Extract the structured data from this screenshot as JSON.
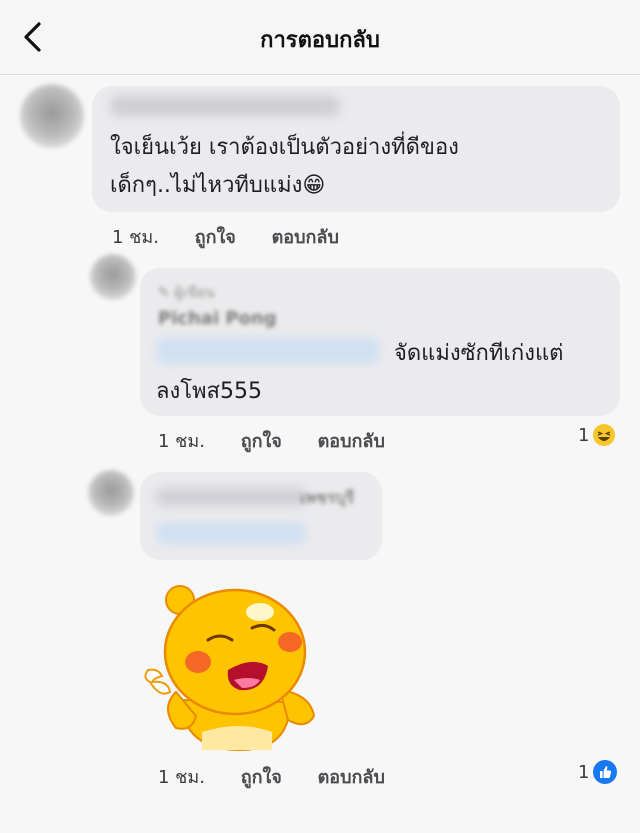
{
  "header": {
    "title": "การตอบกลับ"
  },
  "colors": {
    "like_blue": "#1877f2",
    "emoji_yellow": "#f7c52c",
    "bubble": "#ebebed"
  },
  "comments": [
    {
      "text_lines": [
        "ใจเย็นเว้ย เราต้องเป็นตัวอย่างที่ดีของ",
        "เด็กๆ..ไม่ไหวทีบแม่ง"
      ],
      "emoji": "😁",
      "time": "1 ชม.",
      "like": "ถูกใจ",
      "reply": "ตอบกลับ"
    },
    {
      "top_fan": "ผู้เขียน",
      "author": "Pichai Pong",
      "text_line1": "จัดแม่งซักทีเก่งแต่",
      "text_line2": "ลงโพส555",
      "time": "1 ชม.",
      "like": "ถูกใจ",
      "reply": "ตอบกลับ",
      "reaction_count": "1",
      "reaction_icon": "laughing-emoji"
    },
    {
      "author_fragment": "เพชรบุรี",
      "time": "1 ชม.",
      "like": "ถูกใจ",
      "reply": "ตอบกลับ",
      "reaction_count": "1",
      "reaction_icon": "like-icon"
    }
  ]
}
